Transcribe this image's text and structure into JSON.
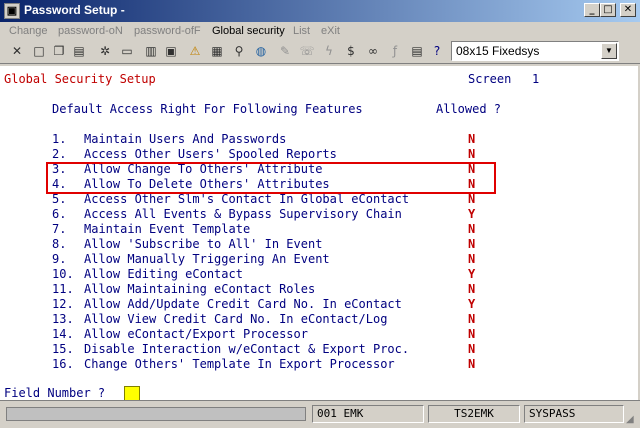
{
  "window": {
    "title": "Password Setup -"
  },
  "menu": [
    {
      "label": "Change",
      "enabled": false
    },
    {
      "label": "password-oN",
      "enabled": false
    },
    {
      "label": "password-ofF",
      "enabled": false
    },
    {
      "label": "Global security",
      "enabled": true
    },
    {
      "label": "List",
      "enabled": false
    },
    {
      "label": "eXit",
      "enabled": false
    }
  ],
  "toolbar": {
    "icons": [
      "cut-icon",
      "new-icon",
      "copy-icon",
      "paste-icon",
      "settings-icon",
      "form-icon",
      "record-icon",
      "print-icon",
      "alert-icon",
      "image-icon",
      "search-icon",
      "globe-icon",
      "edit-icon",
      "dial-icon",
      "lightning-icon",
      "dollar-icon",
      "link-icon",
      "function-icon",
      "notes-icon",
      "help-pointer-icon"
    ],
    "font_select": "08x15 Fixedsys"
  },
  "screen": {
    "title": "Global Security Setup",
    "screen_label": "Screen",
    "screen_number": "1",
    "header_left": "Default Access Right For Following Features",
    "header_right": "Allowed ?",
    "items": [
      {
        "num": "1.",
        "label": "Maintain Users And Passwords",
        "value": "N"
      },
      {
        "num": "2.",
        "label": "Access Other Users' Spooled Reports",
        "value": "N"
      },
      {
        "num": "3.",
        "label": "Allow Change To Others' Attribute",
        "value": "N"
      },
      {
        "num": "4.",
        "label": "Allow To Delete Others' Attributes",
        "value": "N"
      },
      {
        "num": "5.",
        "label": "Access Other Slm's Contact In Global eContact",
        "value": "N"
      },
      {
        "num": "6.",
        "label": "Access All Events & Bypass Supervisory Chain",
        "value": "Y"
      },
      {
        "num": "7.",
        "label": "Maintain Event Template",
        "value": "N"
      },
      {
        "num": "8.",
        "label": "Allow 'Subscribe to All' In Event",
        "value": "N"
      },
      {
        "num": "9.",
        "label": "Allow Manually Triggering An Event",
        "value": "N"
      },
      {
        "num": "10.",
        "label": "Allow Editing eContact",
        "value": "Y"
      },
      {
        "num": "11.",
        "label": "Allow Maintaining eContact Roles",
        "value": "N"
      },
      {
        "num": "12.",
        "label": "Allow Add/Update Credit Card No. In eContact",
        "value": "Y"
      },
      {
        "num": "13.",
        "label": "Allow View Credit Card No. In eContact/Log",
        "value": "N"
      },
      {
        "num": "14.",
        "label": "Allow eContact/Export Processor",
        "value": "N"
      },
      {
        "num": "15.",
        "label": "Disable Interaction w/eContact & Export Proc.",
        "value": "N"
      },
      {
        "num": "16.",
        "label": "Change Others' Template In Export Processor",
        "value": "N"
      }
    ],
    "prompt": "Field Number ?"
  },
  "status": {
    "code": "001 EMK",
    "host": "TS2EMK",
    "system": "SYSPASS"
  },
  "colors": {
    "accent": "#c00000",
    "text": "#000080",
    "highlight": "#e00000",
    "cursor": "#ffff00"
  }
}
